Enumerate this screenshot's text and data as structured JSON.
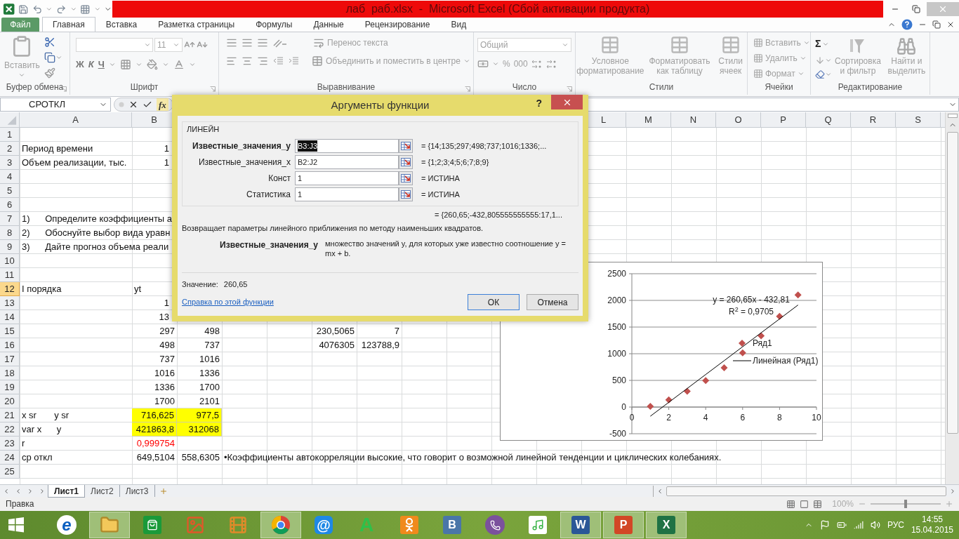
{
  "window": {
    "title": "лаб  раб.xlsx  -  Microsoft Excel (Сбой активации продукта)"
  },
  "ribbon_tabs": [
    {
      "label": "Файл",
      "kind": "file",
      "selected": false
    },
    {
      "label": "Главная",
      "kind": "tab",
      "selected": true
    },
    {
      "label": "Вставка",
      "kind": "tab",
      "selected": false
    },
    {
      "label": "Разметка страницы",
      "kind": "tab",
      "selected": false
    },
    {
      "label": "Формулы",
      "kind": "tab",
      "selected": false
    },
    {
      "label": "Данные",
      "kind": "tab",
      "selected": false
    },
    {
      "label": "Рецензирование",
      "kind": "tab",
      "selected": false
    },
    {
      "label": "Вид",
      "kind": "tab",
      "selected": false
    }
  ],
  "ribbon_groups": [
    {
      "kind": "clipboard",
      "label": "Буфер обмена",
      "paste": "Вставить"
    },
    {
      "kind": "font",
      "label": "Шрифт",
      "font_size": "11",
      "bold": "Ж",
      "italic": "К",
      "underline": "Ч"
    },
    {
      "kind": "alignment",
      "label": "Выравнивание",
      "wrap": "Перенос текста",
      "merge": "Объединить и поместить в центре"
    },
    {
      "kind": "number",
      "label": "Число",
      "format": "Общий",
      "percent": "%",
      "thousands": "000"
    },
    {
      "kind": "styles",
      "label": "Стили",
      "buttons": [
        "Условное форматирование",
        "Форматировать как таблицу",
        "Стили ячеек"
      ]
    },
    {
      "kind": "cells",
      "label": "Ячейки",
      "buttons": [
        "Вставить",
        "Удалить",
        "Формат"
      ]
    },
    {
      "kind": "editing",
      "label": "Редактирование",
      "sum": "Σ",
      "buttons": [
        "Сортировка и фильтр",
        "Найти и выделить"
      ]
    }
  ],
  "formula_bar": {
    "name_box": "СРОТКЛ",
    "function_button": "fx"
  },
  "sheet": {
    "column_headers": {
      "c1": "A",
      "c2": "B",
      "c12": "L",
      "c13": "M",
      "c14": "N",
      "c15": "O",
      "c16": "P",
      "c17": "Q",
      "c18": "R",
      "c19": "S"
    },
    "rows": [
      {
        "number": "1",
        "selected": false
      },
      {
        "number": "2",
        "selected": false,
        "cells": {
          "c1": {
            "text": "Период времени",
            "kind": "text"
          },
          "c2": {
            "text": "1",
            "kind": "number"
          }
        }
      },
      {
        "number": "3",
        "selected": false,
        "cells": {
          "c1": {
            "text": "Объем реализации, тыс.",
            "kind": "text"
          },
          "c2": {
            "text": "1",
            "kind": "number"
          }
        }
      },
      {
        "number": "4",
        "selected": false
      },
      {
        "number": "5",
        "selected": false
      },
      {
        "number": "6",
        "selected": false
      },
      {
        "number": "7",
        "selected": false,
        "cells": {
          "c1": {
            "text": "1)      Определите коэффициенты а",
            "kind": "text"
          }
        }
      },
      {
        "number": "8",
        "selected": false,
        "cells": {
          "c1": {
            "text": "2)      Обоснуйте выбор вида уравн",
            "kind": "text"
          }
        }
      },
      {
        "number": "9",
        "selected": false,
        "cells": {
          "c1": {
            "text": "3)      Дайте прогноз объема реали",
            "kind": "text"
          }
        }
      },
      {
        "number": "10",
        "selected": false
      },
      {
        "number": "11",
        "selected": false
      },
      {
        "number": "12",
        "selected": true,
        "cells": {
          "c1": {
            "text": "I порядка",
            "kind": "text"
          },
          "c2": {
            "text": "yt",
            "kind": "text"
          }
        }
      },
      {
        "number": "13",
        "selected": false,
        "cells": {
          "c2": {
            "text": "1",
            "kind": "number"
          }
        }
      },
      {
        "number": "14",
        "selected": false,
        "cells": {
          "c2": {
            "text": "13",
            "kind": "number"
          }
        }
      },
      {
        "number": "15",
        "selected": false,
        "cells": {
          "c2": {
            "text": "297",
            "kind": "number"
          },
          "c3": {
            "text": "498",
            "kind": "number"
          },
          "c6": {
            "text": "230,5065",
            "kind": "number"
          },
          "c7": {
            "text": "7",
            "kind": "number"
          }
        }
      },
      {
        "number": "16",
        "selected": false,
        "cells": {
          "c2": {
            "text": "498",
            "kind": "number"
          },
          "c3": {
            "text": "737",
            "kind": "number"
          },
          "c6": {
            "text": "4076305",
            "kind": "number"
          },
          "c7": {
            "text": "123788,9",
            "kind": "number"
          }
        }
      },
      {
        "number": "17",
        "selected": false,
        "cells": {
          "c2": {
            "text": "737",
            "kind": "number"
          },
          "c3": {
            "text": "1016",
            "kind": "number"
          }
        }
      },
      {
        "number": "18",
        "selected": false,
        "cells": {
          "c2": {
            "text": "1016",
            "kind": "number"
          },
          "c3": {
            "text": "1336",
            "kind": "number"
          }
        }
      },
      {
        "number": "19",
        "selected": false,
        "cells": {
          "c2": {
            "text": "1336",
            "kind": "number"
          },
          "c3": {
            "text": "1700",
            "kind": "number"
          }
        }
      },
      {
        "number": "20",
        "selected": false,
        "cells": {
          "c2": {
            "text": "1700",
            "kind": "number"
          },
          "c3": {
            "text": "2101",
            "kind": "number"
          }
        }
      },
      {
        "number": "21",
        "selected": false,
        "cells": {
          "c1": {
            "text": "x sr       y sr",
            "kind": "text"
          },
          "c2": {
            "text": "716,625",
            "kind": "highlight"
          },
          "c3": {
            "text": "977,5",
            "kind": "highlight"
          }
        }
      },
      {
        "number": "22",
        "selected": false,
        "cells": {
          "c1": {
            "text": "var x      y",
            "kind": "text"
          },
          "c2": {
            "text": "421863,8",
            "kind": "highlight"
          },
          "c3": {
            "text": "312068",
            "kind": "highlight"
          }
        }
      },
      {
        "number": "23",
        "selected": false,
        "cells": {
          "c1": {
            "text": "r",
            "kind": "text"
          },
          "c2": {
            "text": "0,999754",
            "kind": "alert"
          }
        }
      },
      {
        "number": "24",
        "selected": false,
        "cells": {
          "c1": {
            "text": "ср откл",
            "kind": "text"
          },
          "c2": {
            "text": "649,5104",
            "kind": "number"
          },
          "c3": {
            "text": "558,6305",
            "kind": "number"
          },
          "c4": {
            "text": "•Коэффициенты автокорреляции высокие, что говорит о возможной линейной тенденции и циклических колебаниях.",
            "kind": "text"
          }
        }
      },
      {
        "number": "25",
        "selected": false
      }
    ]
  },
  "chart": {
    "chart_data": {
      "type": "scatter",
      "x": [
        1,
        2,
        3,
        4,
        5,
        6,
        7,
        8,
        9
      ],
      "series": [
        {
          "name": "Ряд1",
          "type": "scatter",
          "color": "#c0504d",
          "values": [
            14,
            135,
            297,
            498,
            737,
            1016,
            1336,
            1700,
            2101
          ]
        },
        {
          "name": "Линейная (Ряд1)",
          "type": "line",
          "color": "#000000",
          "values": [
            -172,
            88,
            349,
            610,
            870,
            1131,
            1392,
            1652,
            1913
          ]
        }
      ],
      "xlim": [
        0,
        10
      ],
      "ylim": [
        -500,
        2500
      ],
      "xticks": [
        0,
        2,
        4,
        6,
        8,
        10
      ],
      "yticks": [
        -500,
        0,
        500,
        1000,
        1500,
        2000,
        2500
      ],
      "grid": true,
      "legend": "right",
      "annotations": [
        "y = 260,65x - 432,81",
        "R$^{2}$ = 0,9705"
      ]
    }
  },
  "dialog": {
    "title": "Аргументы функции",
    "help": "?",
    "function": "ЛИНЕЙН",
    "arguments": [
      {
        "label": "Известные_значения_y",
        "value": "B3:J3",
        "result": "= {14;135;297;498;737;1016;1336;...",
        "selected": true
      },
      {
        "label": "Известные_значения_x",
        "value": "B2:J2",
        "result": "= {1;2;3;4;5;6;7;8;9}",
        "selected": false
      },
      {
        "label": "Конст",
        "value": "1",
        "result": "= ИСТИНА",
        "selected": false
      },
      {
        "label": "Статистика",
        "value": "1",
        "result": "= ИСТИНА",
        "selected": false
      }
    ],
    "result": "= {260,65;-432,805555555555:17,1...",
    "description": "Возвращает параметры линейного приближения по методу наименьших квадратов.",
    "argument_name": "Известные_значения_y",
    "argument_help": "множество значений y, для которых уже известно соотношение y = mx + b.",
    "value_label": "Значение:",
    "value": "260,65",
    "help_link": "Справка по этой функции",
    "buttons": [
      {
        "label": "ОК",
        "default": true
      },
      {
        "label": "Отмена",
        "default": false
      }
    ]
  },
  "sheet_tabs": [
    {
      "label": "Лист1",
      "selected": true
    },
    {
      "label": "Лист2",
      "selected": false
    },
    {
      "label": "Лист3",
      "selected": false
    }
  ],
  "status_bar": {
    "mode": "Правка",
    "zoom": "100%",
    "zoom_slider": {
      "level": 0.5
    }
  },
  "taskbar": {
    "apps": [
      {
        "kind": "ie",
        "glyph": "e",
        "running": false
      },
      {
        "kind": "explorer",
        "running": true
      },
      {
        "kind": "store",
        "running": false
      },
      {
        "kind": "paint",
        "running": false
      },
      {
        "kind": "media",
        "running": false
      },
      {
        "kind": "chrome",
        "running": true
      },
      {
        "kind": "mail",
        "glyph": "@",
        "running": false
      },
      {
        "kind": "letter_a",
        "glyph": "A",
        "running": false
      },
      {
        "kind": "ok",
        "running": false
      },
      {
        "kind": "vk",
        "glyph": "В",
        "running": false
      },
      {
        "kind": "viber",
        "running": false
      },
      {
        "kind": "music",
        "running": false
      },
      {
        "kind": "word",
        "glyph": "W",
        "running": true
      },
      {
        "kind": "powerpoint",
        "glyph": "P",
        "running": true
      },
      {
        "kind": "excel",
        "glyph": "X",
        "running": true
      }
    ],
    "language": "РУС",
    "time": "14:55",
    "date": "15.04.2015"
  }
}
